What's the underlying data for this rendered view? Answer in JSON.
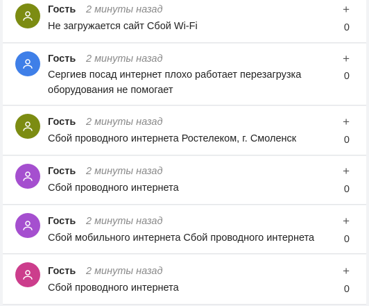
{
  "posts": [
    {
      "author": "Гость",
      "time": "2 минуты назад",
      "text": "Не загружается сайт Сбой Wi-Fi",
      "plus": "+",
      "count": "0",
      "avatar_color": "#7c8c12"
    },
    {
      "author": "Гость",
      "time": "2 минуты назад",
      "text": "Сергиев посад интернет плохо работает перезагрузка оборудования не помогает",
      "plus": "+",
      "count": "0",
      "avatar_color": "#3f7fe8"
    },
    {
      "author": "Гость",
      "time": "2 минуты назад",
      "text": "Сбой проводного интернета Ростелеком, г. Смоленск",
      "plus": "+",
      "count": "0",
      "avatar_color": "#7c8c12"
    },
    {
      "author": "Гость",
      "time": "2 минуты назад",
      "text": "Сбой проводного интернета",
      "plus": "+",
      "count": "0",
      "avatar_color": "#a54fcf"
    },
    {
      "author": "Гость",
      "time": "2 минуты назад",
      "text": "Сбой мобильного интернета Сбой проводного интернета",
      "plus": "+",
      "count": "0",
      "avatar_color": "#a54fcf"
    },
    {
      "author": "Гость",
      "time": "2 минуты назад",
      "text": "Сбой проводного интернета",
      "plus": "+",
      "count": "0",
      "avatar_color": "#cc3d8c"
    }
  ]
}
